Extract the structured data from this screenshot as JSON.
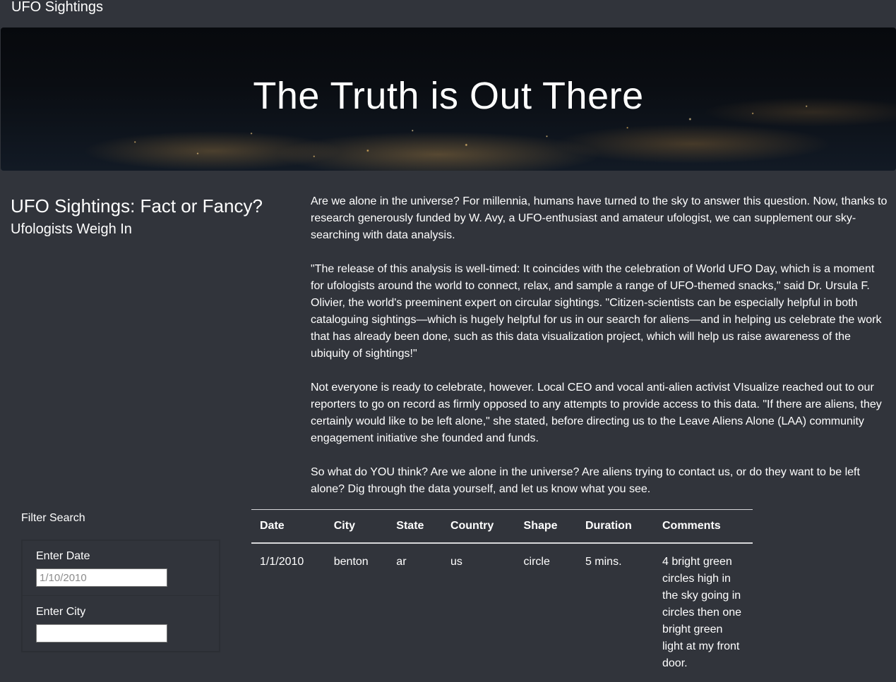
{
  "navbar": {
    "brand": "UFO Sightings"
  },
  "hero": {
    "title": "The Truth is Out There"
  },
  "intro": {
    "headline": "UFO Sightings: Fact or Fancy?",
    "subheadline": "Ufologists Weigh In"
  },
  "article": {
    "paragraphs": [
      "Are we alone in the universe? For millennia, humans have turned to the sky to answer this question. Now, thanks to research generously funded by W. Avy, a UFO-enthusiast and amateur ufologist, we can supplement our sky-searching with data analysis.",
      "\"The release of this analysis is well-timed: It coincides with the celebration of World UFO Day, which is a moment for ufologists around the world to connect, relax, and sample a range of UFO-themed snacks,\" said Dr. Ursula F. Olivier, the world's preeminent expert on circular sightings. \"Citizen-scientists can be especially helpful in both cataloguing sightings—which is hugely helpful for us in our search for aliens—and in helping us celebrate the work that has already been done, such as this data visualization project, which will help us raise awareness of the ubiquity of sightings!\"",
      "Not everyone is ready to celebrate, however. Local CEO and vocal anti-alien activist VIsualize reached out to our reporters to go on record as firmly opposed to any attempts to provide access to this data. \"If there are aliens, they certainly would like to be left alone,\" she stated, before directing us to the Leave Aliens Alone (LAA) community engagement initiative she founded and funds.",
      "So what do YOU think? Are we alone in the universe? Are aliens trying to contact us, or do they want to be left alone? Dig through the data yourself, and let us know what you see."
    ]
  },
  "filters": {
    "title": "Filter Search",
    "date_label": "Enter Date",
    "date_placeholder": "1/10/2010",
    "city_label": "Enter City"
  },
  "table": {
    "headers": [
      "Date",
      "City",
      "State",
      "Country",
      "Shape",
      "Duration",
      "Comments"
    ],
    "rows": [
      {
        "date": "1/1/2010",
        "city": "benton",
        "state": "ar",
        "country": "us",
        "shape": "circle",
        "duration": "5 mins.",
        "comments": "4 bright green circles high in the sky going in circles then one bright green light at my front door."
      }
    ]
  }
}
